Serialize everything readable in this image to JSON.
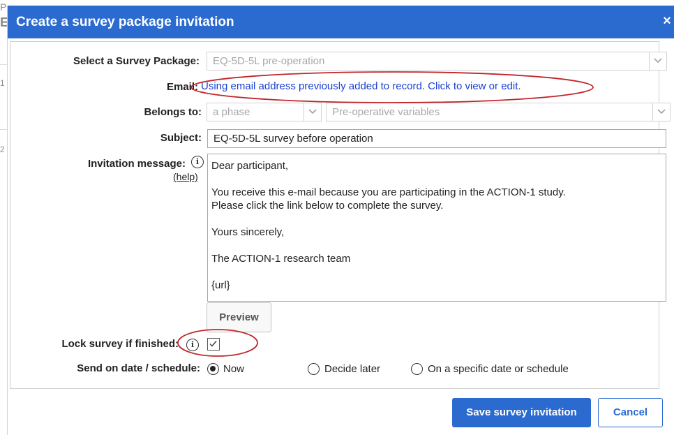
{
  "background": {
    "letters": [
      "P",
      "E",
      "1",
      "2"
    ]
  },
  "dialog": {
    "title": "Create a survey package invitation",
    "close_glyph": "×",
    "header_color": "#2b6bd0"
  },
  "form": {
    "survey_package": {
      "label": "Select a Survey Package:",
      "value": "EQ-5D-5L pre-operation"
    },
    "email": {
      "label": "Email:",
      "link_text": "Using email address previously added to record. Click to view or edit."
    },
    "belongs_to": {
      "label": "Belongs to:",
      "phase_value": "a phase",
      "step_value": "Pre-operative variables"
    },
    "subject": {
      "label": "Subject:",
      "value": "EQ-5D-5L survey before operation"
    },
    "invitation_message": {
      "label": "Invitation message:",
      "help_text": "(help)",
      "info_icon": "info-icon",
      "lines": [
        "Dear participant,",
        "",
        "You receive this e-mail because you are participating in the ACTION-1 study.",
        "Please click the link below to complete the survey.",
        "",
        "Yours sincerely,",
        "",
        "The ACTION-1 research team",
        "",
        "{url}"
      ]
    },
    "preview_label": "Preview",
    "lock_survey": {
      "label": "Lock survey if finished:",
      "checked": true,
      "info_icon": "info-icon"
    },
    "send_on": {
      "label": "Send on date / schedule:",
      "options": [
        "Now",
        "Decide later",
        "On a specific date or schedule"
      ],
      "selected": "Now"
    }
  },
  "footer": {
    "save_label": "Save survey invitation",
    "cancel_label": "Cancel"
  },
  "annotations": {
    "color": "#c0262c"
  }
}
